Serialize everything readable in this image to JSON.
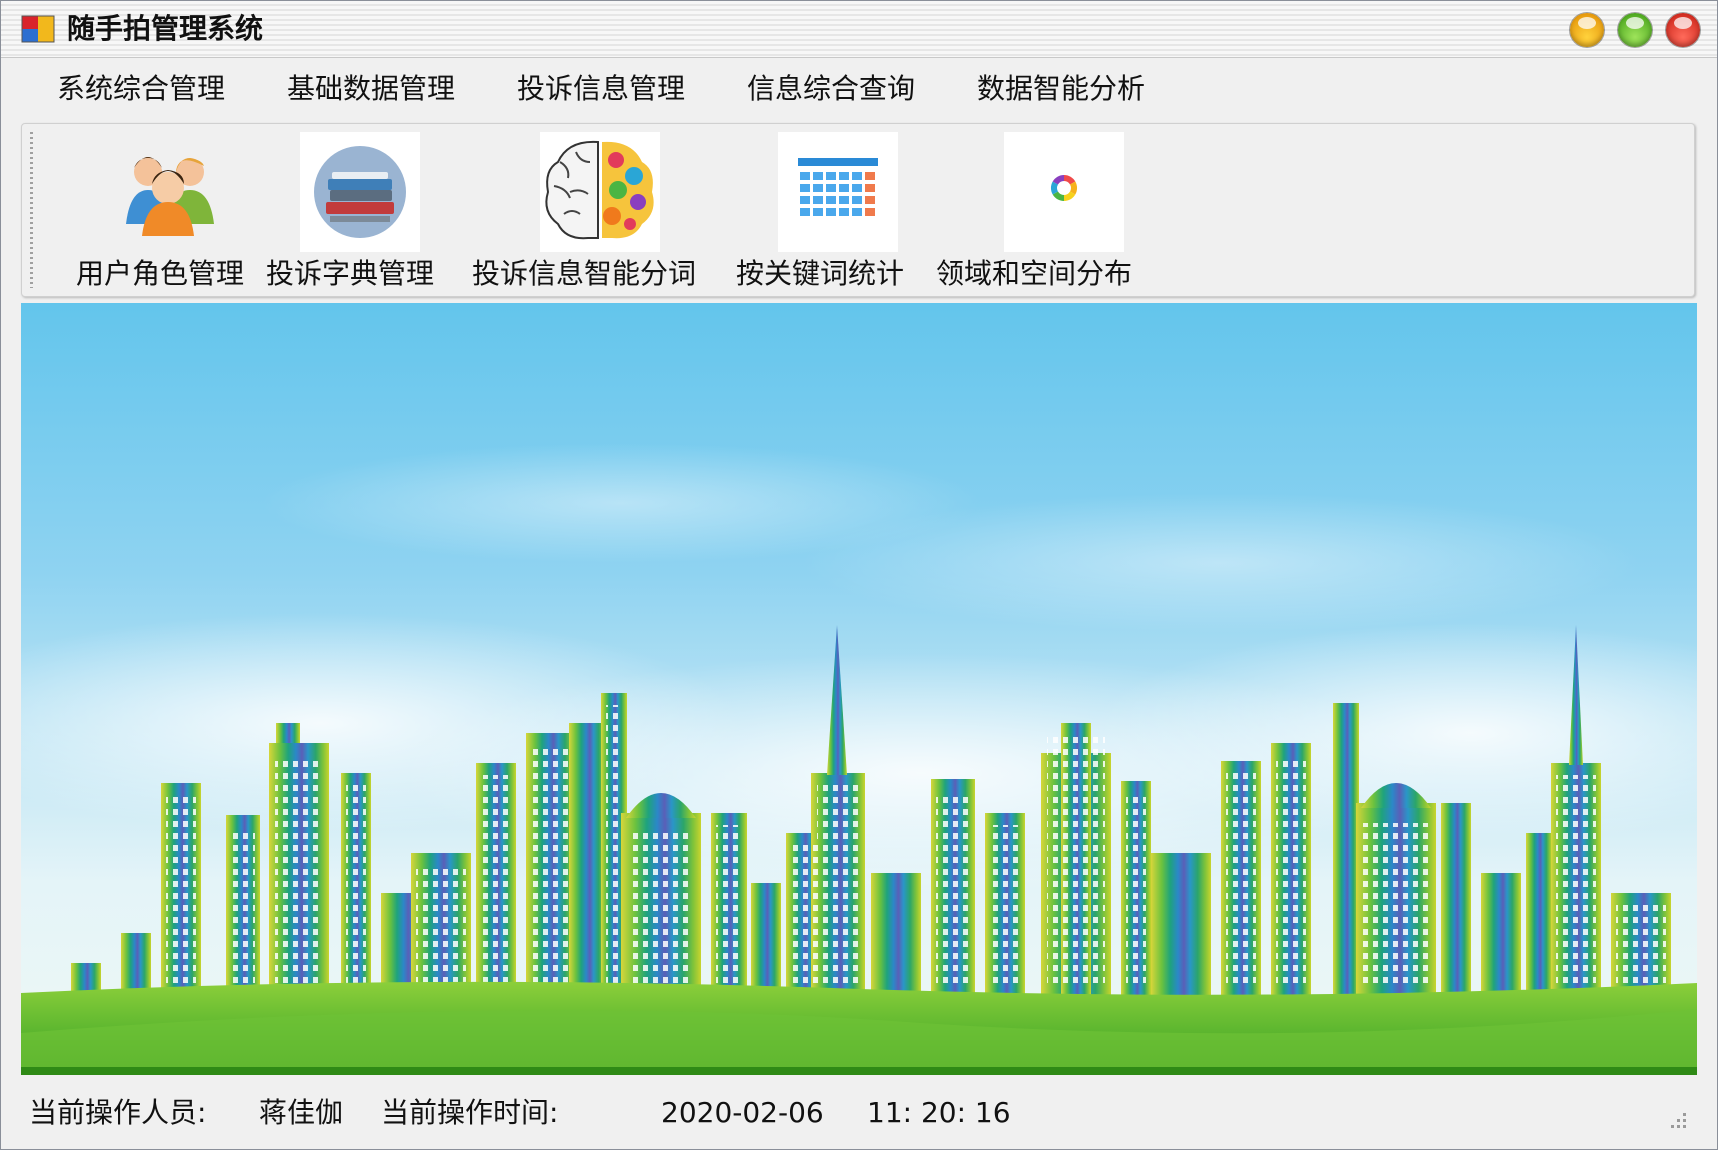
{
  "window": {
    "title": "随手拍管理系统",
    "icon": "app-window-icon",
    "controls": [
      "minimize-button",
      "maximize-button",
      "close-button"
    ]
  },
  "menu": {
    "items": [
      "系统综合管理",
      "基础数据管理",
      "投诉信息管理",
      "信息综合查询",
      "数据智能分析"
    ]
  },
  "toolbar": {
    "tools": [
      {
        "label": "用户角色管理",
        "icon": "users-group-icon"
      },
      {
        "label": "投诉字典管理",
        "icon": "books-stack-icon"
      },
      {
        "label": "投诉信息智能分词",
        "icon": "colorful-brain-icon"
      },
      {
        "label": "按关键词统计",
        "icon": "calendar-grid-icon"
      },
      {
        "label": "领域和空间分布",
        "icon": "color-ring-icon"
      }
    ]
  },
  "banner": {
    "description_icon": "city-skyline-illustration"
  },
  "status": {
    "operator_label": "当前操作人员:",
    "operator_name": "蒋佳伽",
    "time_label": "当前操作时间:",
    "date": "2020-02-06",
    "time": "11: 20: 16"
  },
  "colors": {
    "sky_top": "#63c5ec",
    "grass": "#5fb830",
    "chrome": "#f0f0f0"
  }
}
